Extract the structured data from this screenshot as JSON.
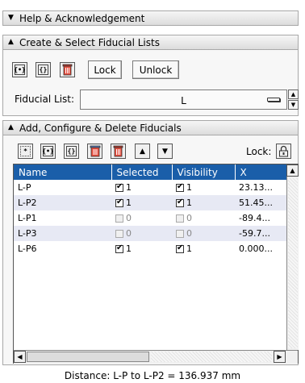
{
  "sections": {
    "help": {
      "label": "Help & Acknowledgement"
    },
    "create": {
      "label": "Create & Select Fiducial Lists"
    },
    "add": {
      "label": "Add, Configure & Delete Fiducials"
    }
  },
  "lists_toolbar": {
    "lock_label": "Lock",
    "unlock_label": "Unlock"
  },
  "fiducial_list": {
    "label": "Fiducial List:",
    "value": "L"
  },
  "fiducials_toolbar": {
    "lock_label": "Lock:"
  },
  "table": {
    "columns": [
      "Name",
      "Selected",
      "Visibility",
      "X"
    ],
    "rows": [
      {
        "name": "L-P",
        "selected": "1",
        "visibility": "1",
        "x": "23.13..."
      },
      {
        "name": "L-P2",
        "selected": "1",
        "visibility": "1",
        "x": "51.45..."
      },
      {
        "name": "L-P1",
        "selected": "0",
        "visibility": "0",
        "x": "-89.4..."
      },
      {
        "name": "L-P3",
        "selected": "0",
        "visibility": "0",
        "x": "-59.7..."
      },
      {
        "name": "L-P6",
        "selected": "1",
        "visibility": "1",
        "x": "0.000..."
      }
    ]
  },
  "status": {
    "distance": "Distance: L-P to L-P2 = 136.937 mm"
  }
}
